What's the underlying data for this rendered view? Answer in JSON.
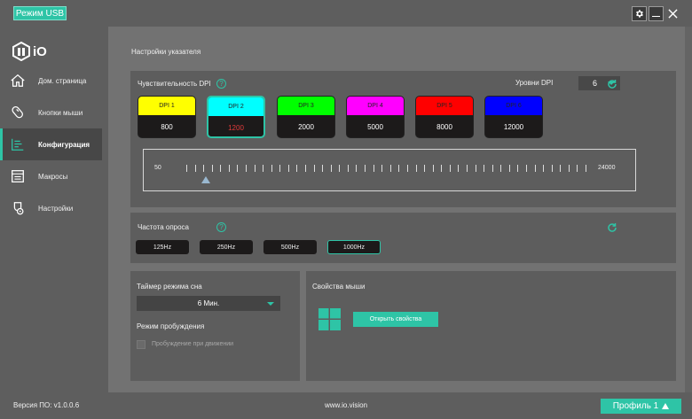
{
  "titlebar": {
    "usb_mode_label": "Режим USB"
  },
  "sidebar": {
    "logo_text": "iO",
    "items": [
      {
        "label": "Дом. страница",
        "icon": "home-icon"
      },
      {
        "label": "Кнопки мыши",
        "icon": "mouse-icon"
      },
      {
        "label": "Конфигурация",
        "icon": "config-icon",
        "active": true
      },
      {
        "label": "Макросы",
        "icon": "macro-icon"
      },
      {
        "label": "Настройки",
        "icon": "settings-icon"
      }
    ]
  },
  "main": {
    "title": "Настройки указателя",
    "dpi": {
      "label": "Чувствительность DPI",
      "levels_label": "Уровни DPI",
      "levels_value": "6",
      "boxes": [
        {
          "name": "DPI 1",
          "value": "800",
          "color": "#ffff00"
        },
        {
          "name": "DPI 2",
          "value": "1200",
          "color": "#00ffff",
          "selected": true
        },
        {
          "name": "DPI 3",
          "value": "2000",
          "color": "#00ff00"
        },
        {
          "name": "DPI 4",
          "value": "5000",
          "color": "#ff00ff"
        },
        {
          "name": "DPI 5",
          "value": "8000",
          "color": "#ff0000"
        },
        {
          "name": "DPI 6",
          "value": "12000",
          "color": "#0000ff"
        }
      ],
      "slider": {
        "min": "50",
        "max": "24000",
        "value": 1200
      }
    },
    "polling": {
      "label": "Частота опроса",
      "options": [
        "125Hz",
        "250Hz",
        "500Hz",
        "1000Hz"
      ],
      "selected": "1000Hz"
    },
    "sleep": {
      "label": "Таймер режима сна",
      "value": "6 Мин.",
      "wake_label": "Режим пробуждения",
      "wake_checkbox_label": "Пробуждение при движении"
    },
    "mouse_props": {
      "label": "Свойства мыши",
      "button_label": "Открыть свойства"
    }
  },
  "footer": {
    "version": "Версия ПО: v1.0.0.6",
    "site": "www.io.vision",
    "profile_label": "Профиль 1"
  },
  "colors": {
    "accent": "#2ec4a6",
    "selected_value": "#e23a3a"
  }
}
